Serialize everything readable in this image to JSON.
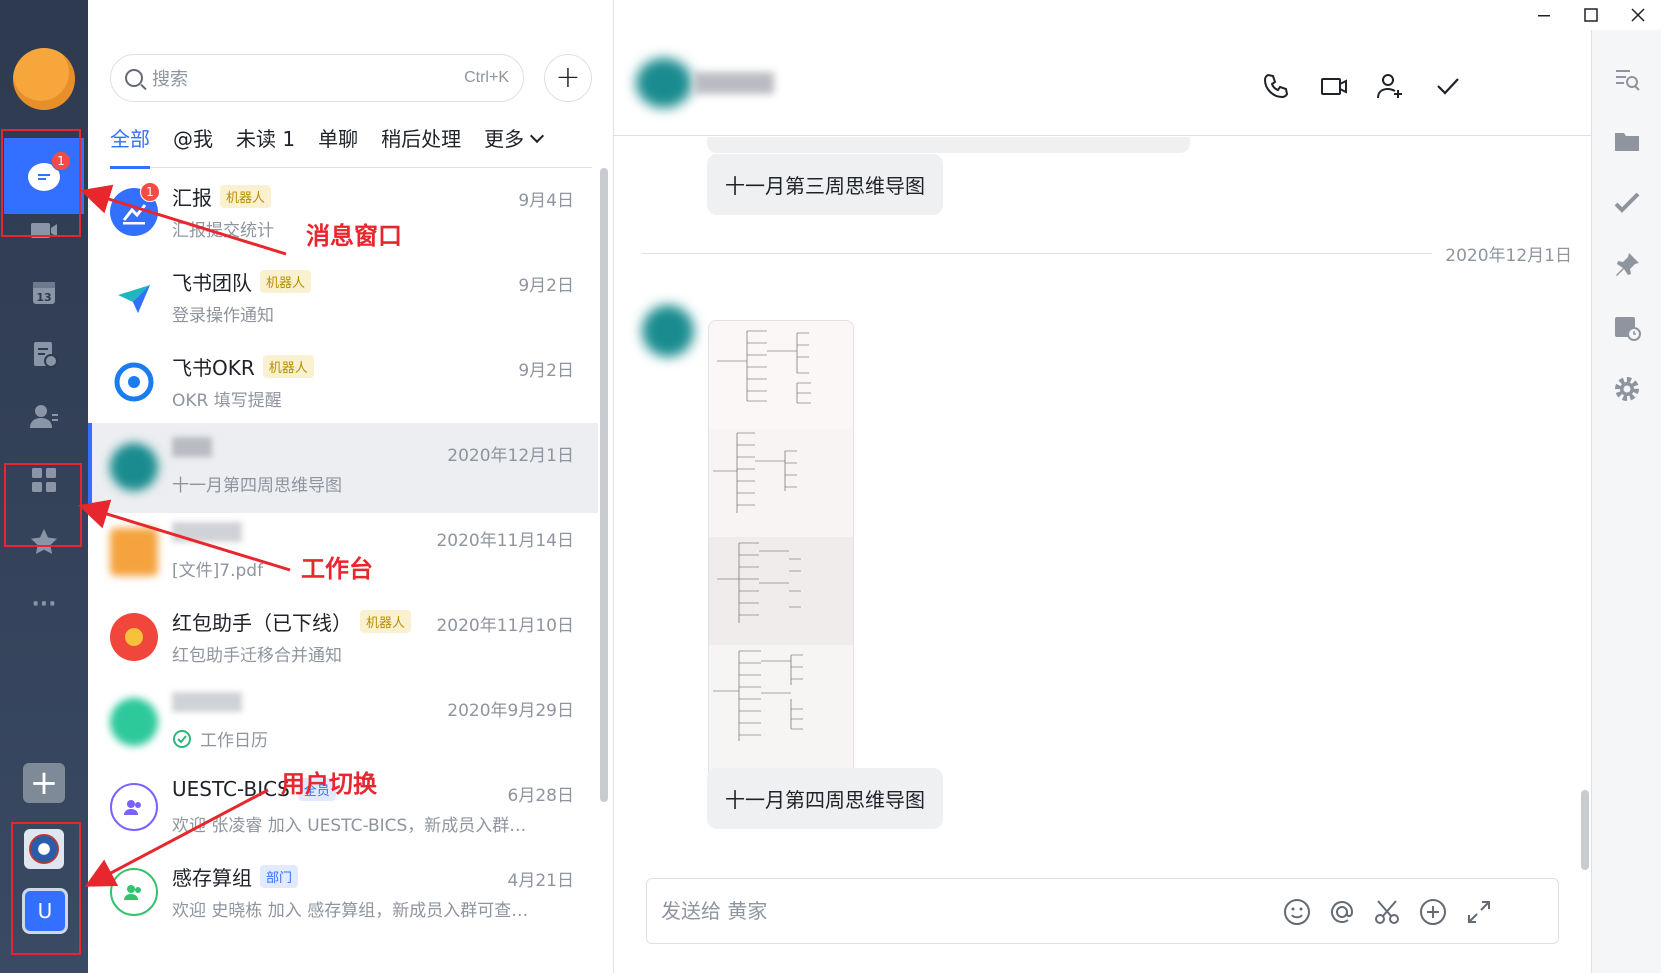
{
  "rail": {
    "chat_badge": "1",
    "user_initial": "U",
    "add_label": "+",
    "more_label": "···"
  },
  "annotations": {
    "messages": "消息窗口",
    "workbench": "工作台",
    "switch_user": "用户切换"
  },
  "search": {
    "placeholder": "搜索",
    "shortcut": "Ctrl+K"
  },
  "add_button": "+",
  "tabs": [
    "全部",
    "@我",
    "未读 1",
    "单聊",
    "稍后处理",
    "更多"
  ],
  "conversations": [
    {
      "name": "汇报",
      "tag": "机器人",
      "preview": "汇报提交统计",
      "time": "9月4日",
      "badge": "1"
    },
    {
      "name": "飞书团队",
      "tag": "机器人",
      "preview": "登录操作通知",
      "time": "9月2日"
    },
    {
      "name": "飞书OKR",
      "tag": "机器人",
      "preview": "OKR 填写提醒",
      "time": "9月2日"
    },
    {
      "name": "",
      "tag": "",
      "preview": "十一月第四周思维导图",
      "time": "2020年12月1日"
    },
    {
      "name": "",
      "tag": "",
      "preview": "[文件]7.pdf",
      "time": "2020年11月14日"
    },
    {
      "name": "红包助手（已下线）",
      "tag": "机器人",
      "preview": "红包助手迁移合并通知",
      "time": "2020年11月10日"
    },
    {
      "name": "",
      "tag": "",
      "preview": "工作日历",
      "time": "2020年9月29日"
    },
    {
      "name": "UESTC-BICS",
      "tag": "全员",
      "preview": "欢迎 张凌睿 加入 UESTC-BICS，新成员入群…",
      "time": "6月28日"
    },
    {
      "name": "感存算组",
      "tag": "部门",
      "preview": "欢迎 史晓栋 加入 感存算组，新成员入群可查…",
      "time": "4月21日"
    }
  ],
  "chat": {
    "messages": [
      {
        "text": "十一月第三周思维导图"
      },
      {
        "text": "十一月第四周思维导图"
      }
    ],
    "date_separator": "2020年12月1日",
    "composer_placeholder": "发送给 黄家"
  },
  "colors": {
    "accent": "#3370ff",
    "annotation": "#e8262d",
    "rail_bg": "#2e3a4f",
    "badge": "#f54a45"
  }
}
